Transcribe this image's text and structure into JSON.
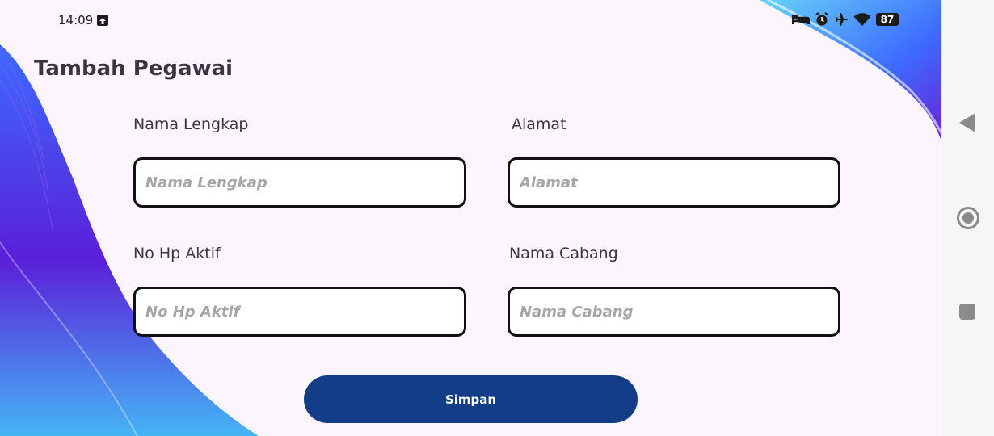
{
  "status_bar": {
    "time": "14:09",
    "battery": "87",
    "icons": [
      "upload-icon",
      "bed-icon",
      "alarm-icon",
      "airplane-icon",
      "wifi-icon",
      "battery-icon"
    ]
  },
  "page": {
    "title": "Tambah Pegawai"
  },
  "form": {
    "fields": [
      {
        "label": "Nama Lengkap",
        "placeholder": "Nama Lengkap",
        "value": ""
      },
      {
        "label": "Alamat",
        "placeholder": "Alamat",
        "value": ""
      },
      {
        "label": "No Hp Aktif",
        "placeholder": "No Hp Aktif",
        "value": ""
      },
      {
        "label": "Nama Cabang",
        "placeholder": "Nama Cabang",
        "value": ""
      }
    ],
    "submit_label": "Simpan"
  },
  "navigation": {
    "icons": [
      "back-icon",
      "home-icon",
      "recents-icon"
    ]
  },
  "colors": {
    "accent": "#133e87",
    "background": "#fdf5fd",
    "wave_blue": "#3d6bff",
    "wave_violet": "#5a1fd8"
  }
}
